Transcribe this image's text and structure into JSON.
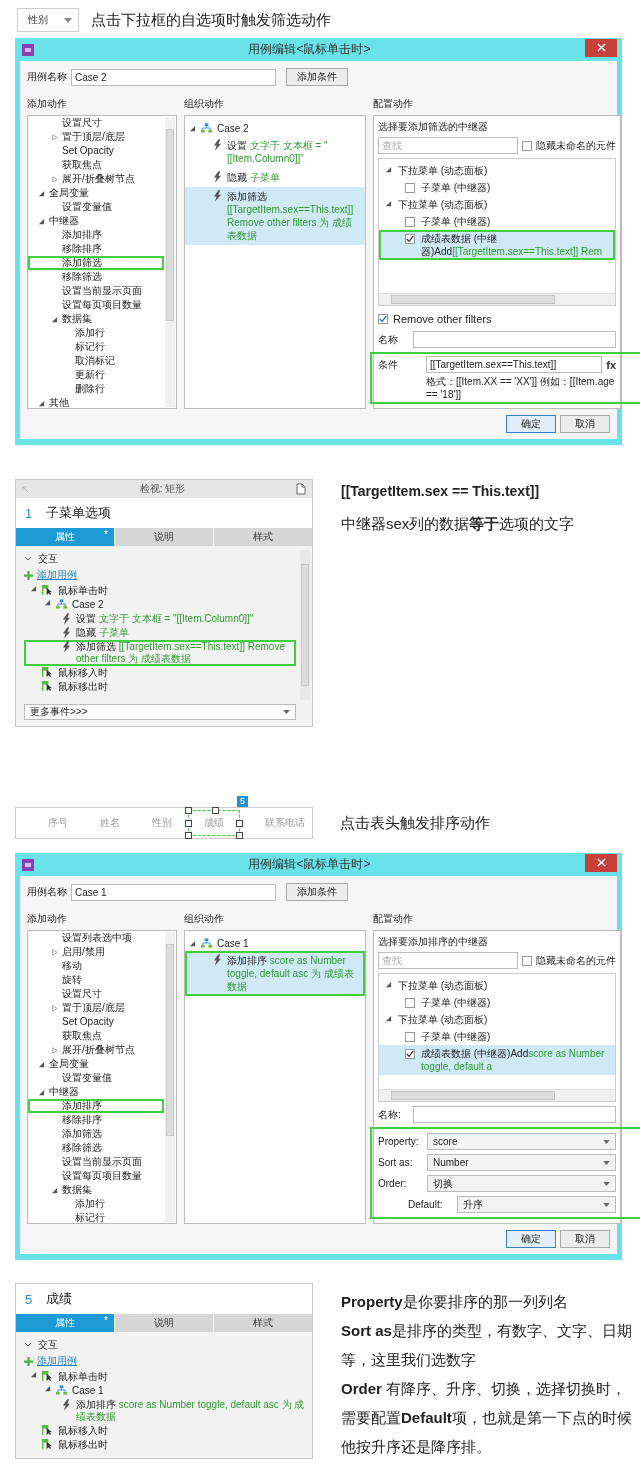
{
  "sections": [
    {
      "kind": "filter_intro",
      "dropdown": "性别",
      "caption": "点击下拉框的自选项时触发筛选动作"
    },
    {
      "kind": "dialog",
      "title": "用例编辑<鼠标单击时>",
      "name_label": "用例名称",
      "name_value": "Case 2",
      "condition_button": "添加条件",
      "actions_heading": "添加动作",
      "organize_heading": "组织动作",
      "config_heading": "配置动作",
      "actions_continued": [
        {
          "kind": "action",
          "label": "设置尺寸",
          "highlighted": false
        },
        {
          "kind": "group",
          "label": "置于顶层/底层",
          "expanded": false,
          "highlighted": false
        },
        {
          "kind": "action",
          "label": "Set Opacity",
          "highlighted": false
        },
        {
          "kind": "action",
          "label": "获取焦点",
          "highlighted": false
        },
        {
          "kind": "group",
          "label": "展开/折叠树节点",
          "expanded": false,
          "highlighted": false
        }
      ],
      "actions": [
        {
          "kind": "group",
          "label": "全局变量",
          "expanded": true,
          "highlighted": false,
          "children": [
            {
              "kind": "action",
              "label": "设置变量值",
              "highlighted": false
            }
          ]
        },
        {
          "kind": "group",
          "label": "中继器",
          "expanded": true,
          "highlighted": false,
          "children": [
            {
              "kind": "action",
              "label": "添加排序",
              "highlighted": false
            },
            {
              "kind": "action",
              "label": "移除排序",
              "highlighted": false
            },
            {
              "kind": "action",
              "label": "添加筛选",
              "highlighted": true
            },
            {
              "kind": "action",
              "label": "移除筛选",
              "highlighted": false
            },
            {
              "kind": "action",
              "label": "设置当前显示页面",
              "highlighted": false
            },
            {
              "kind": "action",
              "label": "设置每页项目数量",
              "highlighted": false
            },
            {
              "kind": "group",
              "label": "数据集",
              "expanded": true,
              "highlighted": false,
              "children": [
                {
                  "kind": "action",
                  "label": "添加行",
                  "highlighted": false
                },
                {
                  "kind": "action",
                  "label": "标记行",
                  "highlighted": false
                },
                {
                  "kind": "action",
                  "label": "取消标记",
                  "highlighted": false
                },
                {
                  "kind": "action",
                  "label": "更新行",
                  "highlighted": false
                },
                {
                  "kind": "action",
                  "label": "删除行",
                  "highlighted": false
                }
              ]
            }
          ]
        },
        {
          "kind": "group",
          "label": "其他",
          "expanded": true,
          "highlighted": false
        }
      ],
      "case": {
        "label": "Case 2",
        "expanded": true,
        "steps": [
          {
            "verb": "设置",
            "detail": "文字于 文本框 = \"[[Item.Column0]]\"",
            "selected": false,
            "highlighted": false
          },
          {
            "verb": "隐藏",
            "detail": "子菜单",
            "selected": false,
            "highlighted": false
          },
          {
            "verb": "添加筛选",
            "detail": "[[TargetItem.sex==This.text]] Remove other filters 为 成绩表数据",
            "selected": true,
            "highlighted": false
          }
        ]
      },
      "repeater_heading": "选择要添加筛选的中继器",
      "search_placeholder": "查找",
      "hide_unnamed": {
        "label": "隐藏未命名的元件",
        "checked": false
      },
      "repeaters": [
        {
          "kind": "group",
          "label": "下拉菜单 (动态面板)",
          "expanded": true,
          "children": [
            {
              "kind": "repeater",
              "label": "子菜单 (中继器)",
              "checked": false,
              "selected": false,
              "highlighted": false
            }
          ]
        },
        {
          "kind": "group",
          "label": "下拉菜单 (动态面板)",
          "expanded": true,
          "children": [
            {
              "kind": "repeater",
              "label": "子菜单 (中继器)",
              "checked": false,
              "selected": false,
              "highlighted": false
            },
            {
              "kind": "repeater",
              "label": "成绩表数据 (中继器)",
              "action": "Add",
              "detail": "[[TargetItem.sex==This.text]] Rem",
              "checked": true,
              "selected": true,
              "highlighted": true
            }
          ]
        }
      ],
      "fields": [
        {
          "kind": "checkbox",
          "label": "Remove other filters",
          "checked": true
        },
        {
          "kind": "text",
          "label": "名称"
        }
      ],
      "highlighted_fields": [
        {
          "kind": "condition",
          "label": "条件",
          "value": "[[TargetItem.sex==This.text]]",
          "button": "fx",
          "hint": "格式：[[Item.XX == 'XX']] 例如：[[Item.age == '18']]"
        }
      ],
      "buttons": [
        {
          "label": "确定",
          "default": true
        },
        {
          "label": "取消",
          "default": false
        }
      ]
    },
    {
      "kind": "inspector_note",
      "inspector": {
        "header": "检视: 矩形",
        "number": "1",
        "title": "子菜单选项",
        "tabs": [
          {
            "label": "属性",
            "selected": true,
            "marker": "*"
          },
          {
            "label": "说明",
            "selected": false
          },
          {
            "label": "样式",
            "selected": false
          }
        ],
        "section": "交互",
        "section_expanded": true,
        "add_case": "添加用例",
        "events": [
          {
            "label": "鼠标单击时",
            "expanded": true,
            "cases": [
              {
                "label": "Case 2",
                "expanded": true,
                "steps": [
                  {
                    "verb": "设置",
                    "detail": "文字于 文本框 = \"[[Item.Column0]]\"",
                    "highlighted": false
                  },
                  {
                    "verb": "隐藏",
                    "detail": "子菜单",
                    "highlighted": false
                  },
                  {
                    "verb": "添加筛选",
                    "detail": "[[TargetItem.sex==This.text]] Remove other filters 为 成绩表数据",
                    "highlighted": true
                  }
                ]
              }
            ]
          },
          {
            "label": "鼠标移入时"
          },
          {
            "label": "鼠标移出时"
          }
        ],
        "more_events": "更多事件>>>"
      },
      "note": {
        "heading": "[[TargetItem.sex == This.text]]",
        "paragraphs": [
          "中继器sex列的数据**等于**选项的文字"
        ]
      }
    },
    {
      "kind": "sort_intro",
      "columns": [
        {
          "label": "序号",
          "selected": false
        },
        {
          "label": "姓名",
          "selected": false
        },
        {
          "label": "性别",
          "selected": false
        },
        {
          "label": "成绩",
          "selected": true,
          "badge": "5"
        },
        {
          "label": "联系电话",
          "selected": false
        }
      ],
      "caption": "点击表头触发排序动作"
    },
    {
      "kind": "dialog",
      "title": "用例编辑<鼠标单击时>",
      "name_label": "用例名称",
      "name_value": "Case 1",
      "condition_button": "添加条件",
      "actions_heading": "添加动作",
      "organize_heading": "组织动作",
      "config_heading": "配置动作",
      "actions_continued": [
        {
          "kind": "action",
          "label": "设置列表选中项",
          "highlighted": false
        },
        {
          "kind": "group",
          "label": "启用/禁用",
          "expanded": false,
          "highlighted": false
        },
        {
          "kind": "action",
          "label": "移动",
          "highlighted": false
        },
        {
          "kind": "action",
          "label": "旋转",
          "highlighted": false
        },
        {
          "kind": "action",
          "label": "设置尺寸",
          "highlighted": false
        },
        {
          "kind": "group",
          "label": "置于顶层/底层",
          "expanded": false,
          "highlighted": false
        },
        {
          "kind": "action",
          "label": "Set Opacity",
          "highlighted": false
        },
        {
          "kind": "action",
          "label": "获取焦点",
          "highlighted": false
        },
        {
          "kind": "group",
          "label": "展开/折叠树节点",
          "expanded": false,
          "highlighted": false
        }
      ],
      "actions": [
        {
          "kind": "group",
          "label": "全局变量",
          "expanded": true,
          "highlighted": false,
          "children": [
            {
              "kind": "action",
              "label": "设置变量值",
              "highlighted": false
            }
          ]
        },
        {
          "kind": "group",
          "label": "中继器",
          "expanded": true,
          "highlighted": false,
          "children": [
            {
              "kind": "action",
              "label": "添加排序",
              "highlighted": true
            },
            {
              "kind": "action",
              "label": "移除排序",
              "highlighted": false
            },
            {
              "kind": "action",
              "label": "添加筛选",
              "highlighted": false
            },
            {
              "kind": "action",
              "label": "移除筛选",
              "highlighted": false
            },
            {
              "kind": "action",
              "label": "设置当前显示页面",
              "highlighted": false
            },
            {
              "kind": "action",
              "label": "设置每页项目数量",
              "highlighted": false
            },
            {
              "kind": "group",
              "label": "数据集",
              "expanded": true,
              "highlighted": false,
              "children": [
                {
                  "kind": "action",
                  "label": "添加行",
                  "highlighted": false
                },
                {
                  "kind": "action",
                  "label": "标记行",
                  "highlighted": false
                }
              ]
            }
          ]
        }
      ],
      "case": {
        "label": "Case 1",
        "expanded": true,
        "steps": [
          {
            "verb": "添加排序",
            "detail": "score as Number toggle, default asc 为 成绩表数据",
            "selected": true,
            "highlighted": true
          }
        ]
      },
      "repeater_heading": "选择要添加排序的中继器",
      "search_placeholder": "查找",
      "hide_unnamed": {
        "label": "隐藏未命名的元件",
        "checked": false
      },
      "repeaters": [
        {
          "kind": "group",
          "label": "下拉菜单 (动态面板)",
          "expanded": true,
          "children": [
            {
              "kind": "repeater",
              "label": "子菜单 (中继器)",
              "checked": false,
              "selected": false,
              "highlighted": false
            }
          ]
        },
        {
          "kind": "group",
          "label": "下拉菜单 (动态面板)",
          "expanded": true,
          "children": [
            {
              "kind": "repeater",
              "label": "子菜单 (中继器)",
              "checked": false,
              "selected": false,
              "highlighted": false
            },
            {
              "kind": "repeater",
              "label": "成绩表数据 (中继器)",
              "action": "Add",
              "detail": "score as Number toggle, default a",
              "checked": true,
              "selected": true,
              "highlighted": false
            }
          ]
        }
      ],
      "fields": [
        {
          "kind": "text",
          "label": "名称:"
        }
      ],
      "highlighted_fields": [
        {
          "kind": "select",
          "label": "Property:",
          "value": "score"
        },
        {
          "kind": "select",
          "label": "Sort as:",
          "value": "Number"
        },
        {
          "kind": "select",
          "label": "Order:",
          "value": "切换",
          "children": [
            {
              "kind": "select",
              "label": "Default:",
              "value": "升序"
            }
          ]
        }
      ],
      "buttons": [
        {
          "label": "确定",
          "default": true
        },
        {
          "label": "取消",
          "default": false
        }
      ]
    },
    {
      "kind": "inspector_note",
      "inspector": {
        "number": "5",
        "title": "成绩",
        "tabs": [
          {
            "label": "属性",
            "selected": true,
            "marker": "*"
          },
          {
            "label": "说明",
            "selected": false
          },
          {
            "label": "样式",
            "selected": false
          }
        ],
        "section": "交互",
        "section_expanded": true,
        "add_case": "添加用例",
        "events": [
          {
            "label": "鼠标单击时",
            "expanded": true,
            "cases": [
              {
                "label": "Case 1",
                "expanded": true,
                "steps": [
                  {
                    "verb": "添加排序",
                    "detail": "score as Number toggle, default asc 为 成绩表数据",
                    "highlighted": false
                  }
                ]
              }
            ]
          },
          {
            "label": "鼠标移入时"
          },
          {
            "label": "鼠标移出时"
          }
        ]
      },
      "note": {
        "paragraphs": [
          "**Property**是你要排序的那一列列名",
          "**Sort as**是排序的类型，有数字、文字、日期等，这里我们选数字",
          "**Order** 有降序、升序、切换，选择切换时，需要配置**Default**项，也就是第一下点的时候他按升序还是降序排。"
        ]
      }
    }
  ]
}
